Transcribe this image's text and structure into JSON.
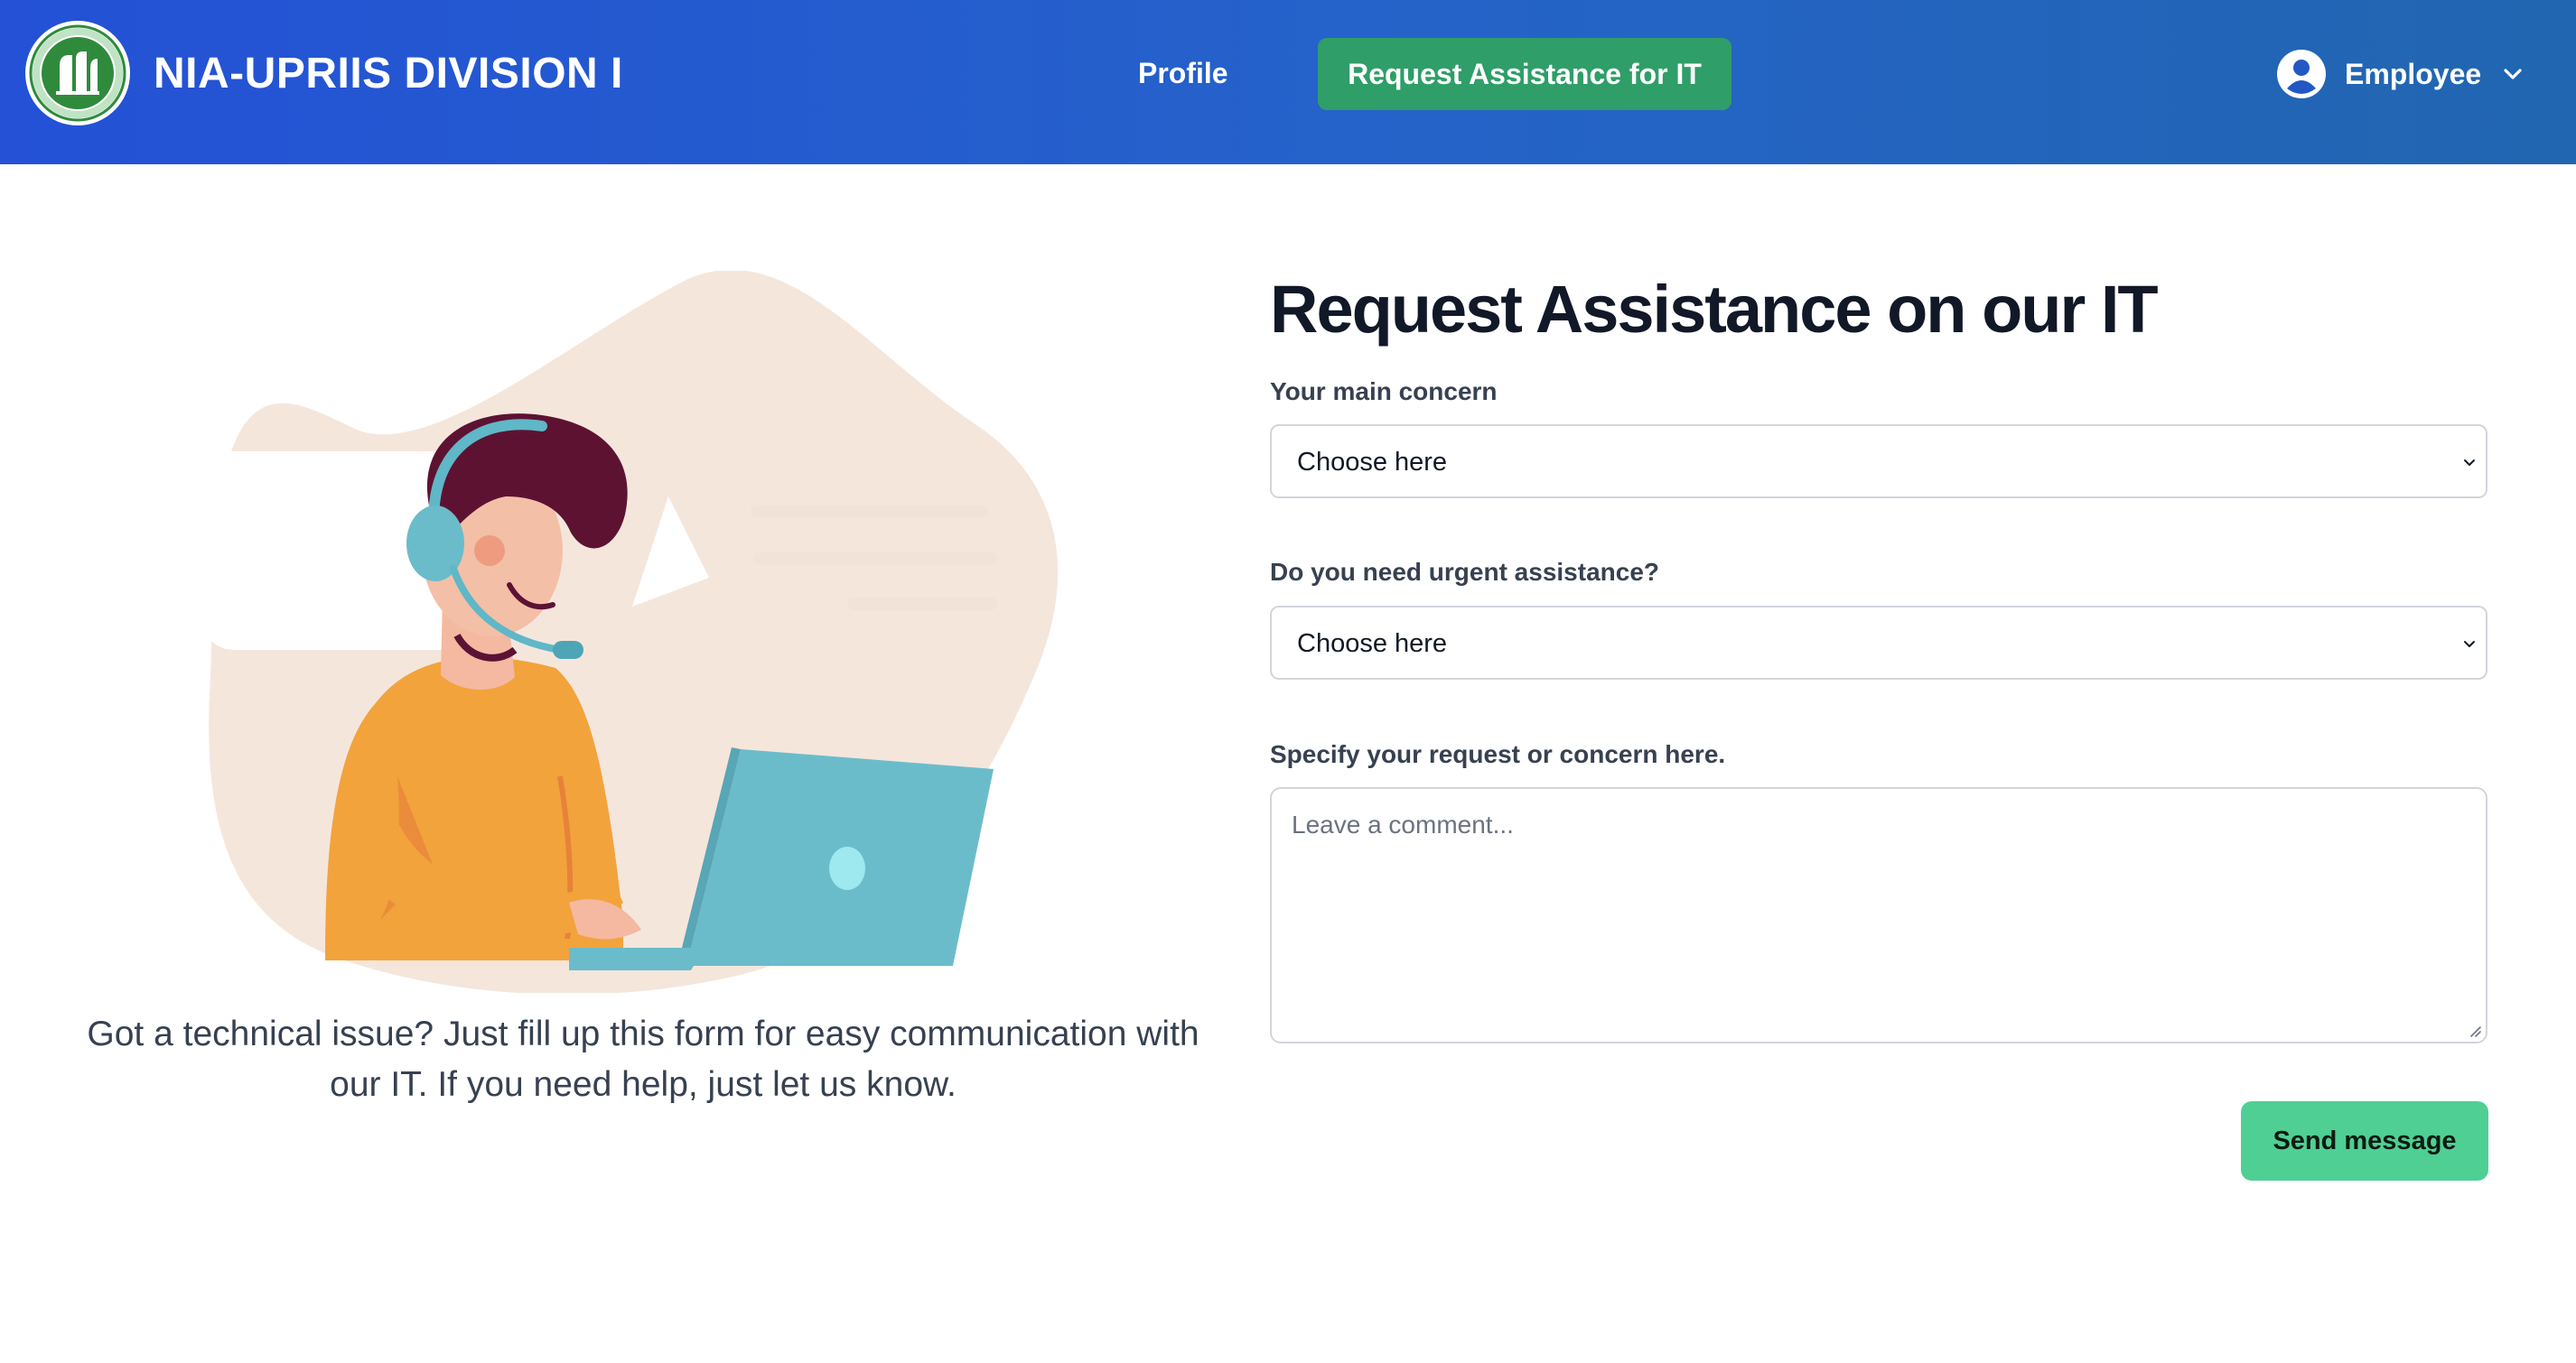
{
  "navbar": {
    "brand": "NIA-UPRIIS DIVISION I",
    "logo_icon": "nia-seal-logo",
    "links": {
      "profile": "Profile",
      "request_it": "Request Assistance for IT"
    },
    "user": {
      "label": "Employee",
      "icon": "user-circle-icon",
      "menu_icon": "chevron-down-icon"
    },
    "colors": {
      "gradient_start": "#2451d6",
      "gradient_end": "#2166b0",
      "active_button": "#2f9e68"
    }
  },
  "illustration": {
    "subject": "support-agent-with-headset-and-laptop-icon",
    "caption": "Got a technical issue? Just fill up this form for easy communication with our IT. If you need help, just let us know."
  },
  "form": {
    "title": "Request Assistance on our IT",
    "concern": {
      "label": "Your main concern",
      "value": "Choose here"
    },
    "urgent": {
      "label": "Do you need urgent assistance?",
      "value": "Choose here"
    },
    "details": {
      "label": "Specify your request or concern here.",
      "placeholder": "Leave a comment..."
    },
    "submit_label": "Send message",
    "colors": {
      "submit": "#4fcf94"
    }
  }
}
